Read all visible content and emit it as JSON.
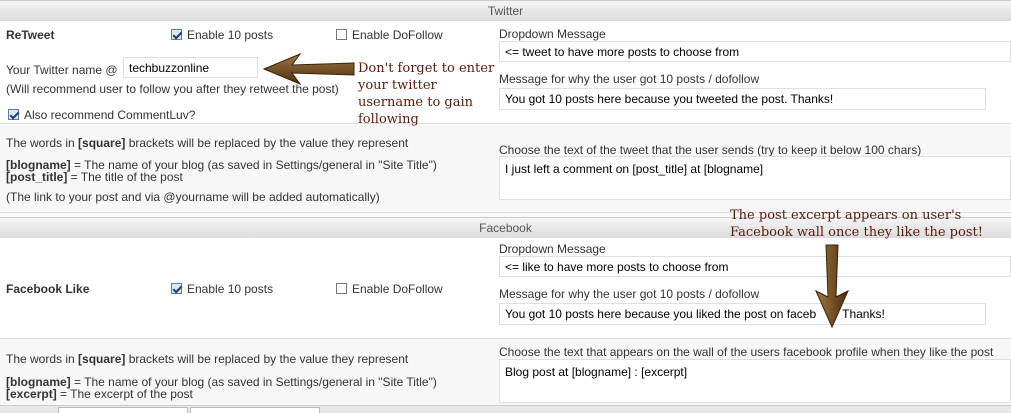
{
  "twitter": {
    "section_title": "Twitter",
    "retweet_label": "ReTweet",
    "enable_posts_label": "Enable 10 posts",
    "enable_dofollow_label": "Enable DoFollow",
    "dropdown_message_label": "Dropdown Message",
    "dropdown_message_value": "<= tweet to have more posts to choose from",
    "username_label": "Your Twitter name @",
    "username_value": "techbuzzonline",
    "username_hint": "(Will recommend user to follow you after they retweet the post)",
    "why_label": "Message for why the user got 10 posts / dofollow",
    "why_value": "You got 10 posts here because you tweeted the post. Thanks!",
    "also_recommend_label": "Also recommend CommentLuv?",
    "replace_intro_a": "The words in ",
    "replace_intro_b": "[square]",
    "replace_intro_c": " brackets will be replaced by the value they represent",
    "blogname_key": "[blogname]",
    "blogname_desc": " = The name of your blog (as saved in Settings/general in \"Site Title\")",
    "post_title_key": "[post_title]",
    "post_title_desc": " = The title of the post",
    "auto_note": "(The link to your post and via @yourname will be added automatically)",
    "tweet_text_label": "Choose the text of the tweet that the user sends (try to keep it below 100 chars)",
    "tweet_text_value": "I just left a comment on [post_title] at [blogname]",
    "annotation": "Don't forget to enter your twitter username to gain following"
  },
  "facebook": {
    "section_title": "Facebook",
    "like_label": "Facebook Like",
    "enable_posts_label": "Enable 10 posts",
    "enable_dofollow_label": "Enable DoFollow",
    "dropdown_message_label": "Dropdown Message",
    "dropdown_message_value": "<= like to have more posts to choose from",
    "why_label": "Message for why the user got 10 posts / dofollow",
    "why_value": "You got 10 posts here because you liked the post on faceb",
    "why_value_tail": "Thanks!",
    "replace_intro_a": "The words in ",
    "replace_intro_b": "[square]",
    "replace_intro_c": " brackets will be replaced by the value they represent",
    "blogname_key": "[blogname]",
    "blogname_desc": " = The name of your blog (as saved in Settings/general in \"Site Title\")",
    "excerpt_key": "[excerpt]",
    "excerpt_desc": " = The excerpt of the post",
    "wall_text_label": "Choose the text that appears on the wall of the users facebook profile when they like the post",
    "wall_text_value": "Blog post at [blogname] : [excerpt]",
    "annotation": "The post excerpt appears on user's Facebook wall once they like the post!"
  },
  "colors": {
    "annotation_text": "#5a1a0a",
    "arrow": "#6b4a1e",
    "checkbox_check": "#1d3d7a"
  }
}
